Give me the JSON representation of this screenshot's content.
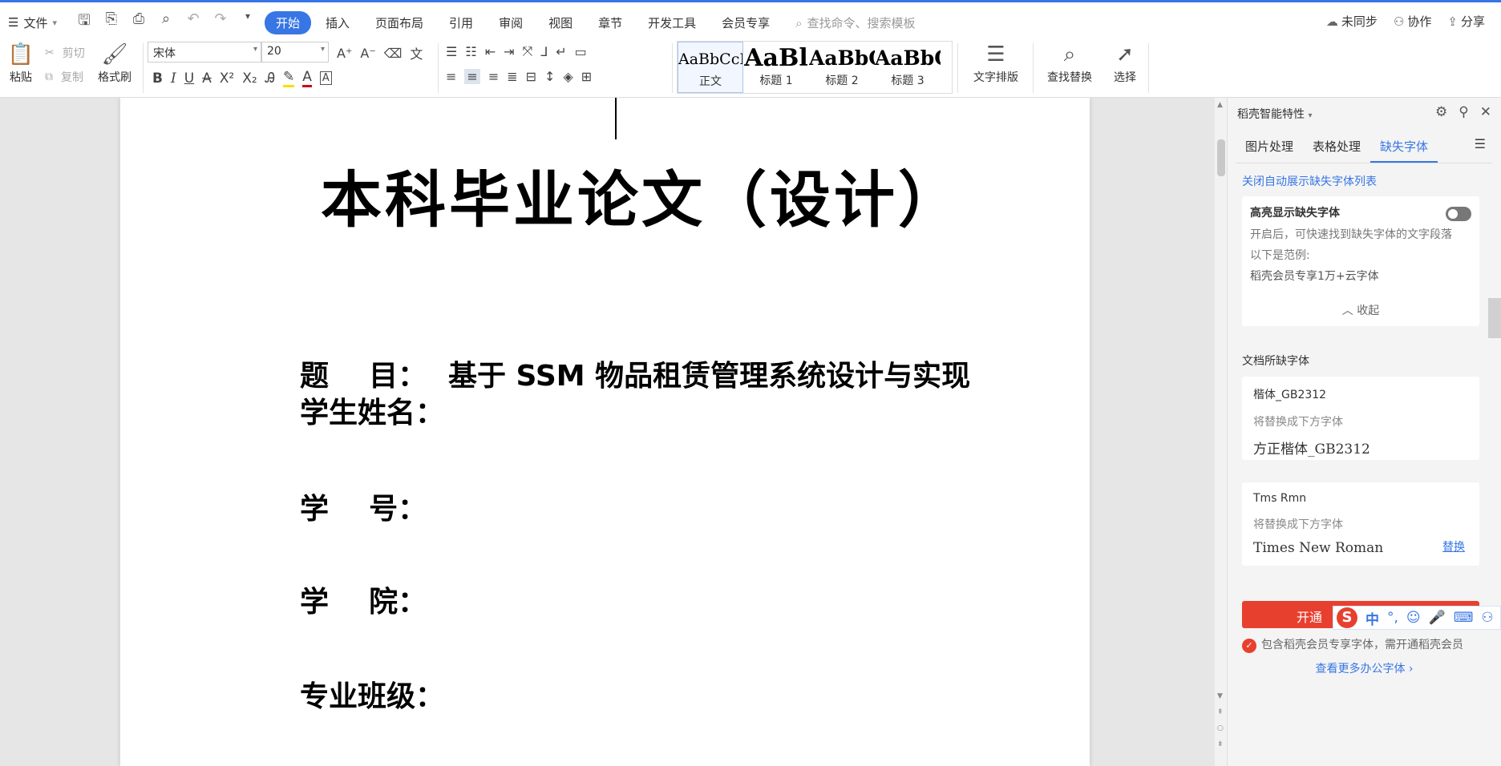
{
  "menu": {
    "file_label": "文件"
  },
  "tabs": [
    "开始",
    "插入",
    "页面布局",
    "引用",
    "审阅",
    "视图",
    "章节",
    "开发工具",
    "会员专享"
  ],
  "search": {
    "placeholder": "查找命令、搜索模板"
  },
  "top_right": {
    "sync": "未同步",
    "collab": "协作",
    "share": "分享"
  },
  "ribbon": {
    "paste": "粘贴",
    "cut": "剪切",
    "copy": "复制",
    "format_painter": "格式刷",
    "font_name": "宋体",
    "font_size": "20",
    "styles": [
      {
        "preview": "AaBbCcI",
        "label": "正文"
      },
      {
        "preview": "AaBl",
        "label": "标题 1"
      },
      {
        "preview": "AaBbC",
        "label": "标题 2"
      },
      {
        "preview": "AaBbC",
        "label": "标题 3"
      }
    ],
    "text_layout": "文字排版",
    "find_replace": "查找替换",
    "select": "选择"
  },
  "document": {
    "title": "本科毕业论文（设计）",
    "fields": [
      {
        "label": "题    目：",
        "value": "基于 SSM 物品租赁管理系统设计与实现"
      },
      {
        "label": "学生姓名：",
        "value": ""
      },
      {
        "label": "学    号：",
        "value": ""
      },
      {
        "label": "学    院：",
        "value": ""
      },
      {
        "label": "专业班级：",
        "value": ""
      }
    ]
  },
  "panel": {
    "title": "稻壳智能特性",
    "tabs": [
      "图片处理",
      "表格处理",
      "缺失字体"
    ],
    "link": "关闭自动展示缺失字体列表",
    "highlight": {
      "title": "高亮显示缺失字体",
      "desc1": "开启后，可快速找到缺失字体的文字段落",
      "desc2": "以下是范例:",
      "desc3": "稻壳会员专享1万+云字体",
      "collapse": "收起"
    },
    "section": "文档所缺字体",
    "fonts": [
      {
        "name": "楷体_GB2312",
        "hint": "将替换成下方字体",
        "replacement": "方正楷体_GB2312",
        "action": ""
      },
      {
        "name": "Tms Rmn",
        "hint": "将替换成下方字体",
        "replacement": "Times New Roman",
        "action": "替换"
      }
    ],
    "open_button": "开通",
    "note": "包含稻壳会员专享字体，需开通稻壳会员",
    "more": "查看更多办公字体"
  },
  "ime": {
    "mode": "中"
  }
}
